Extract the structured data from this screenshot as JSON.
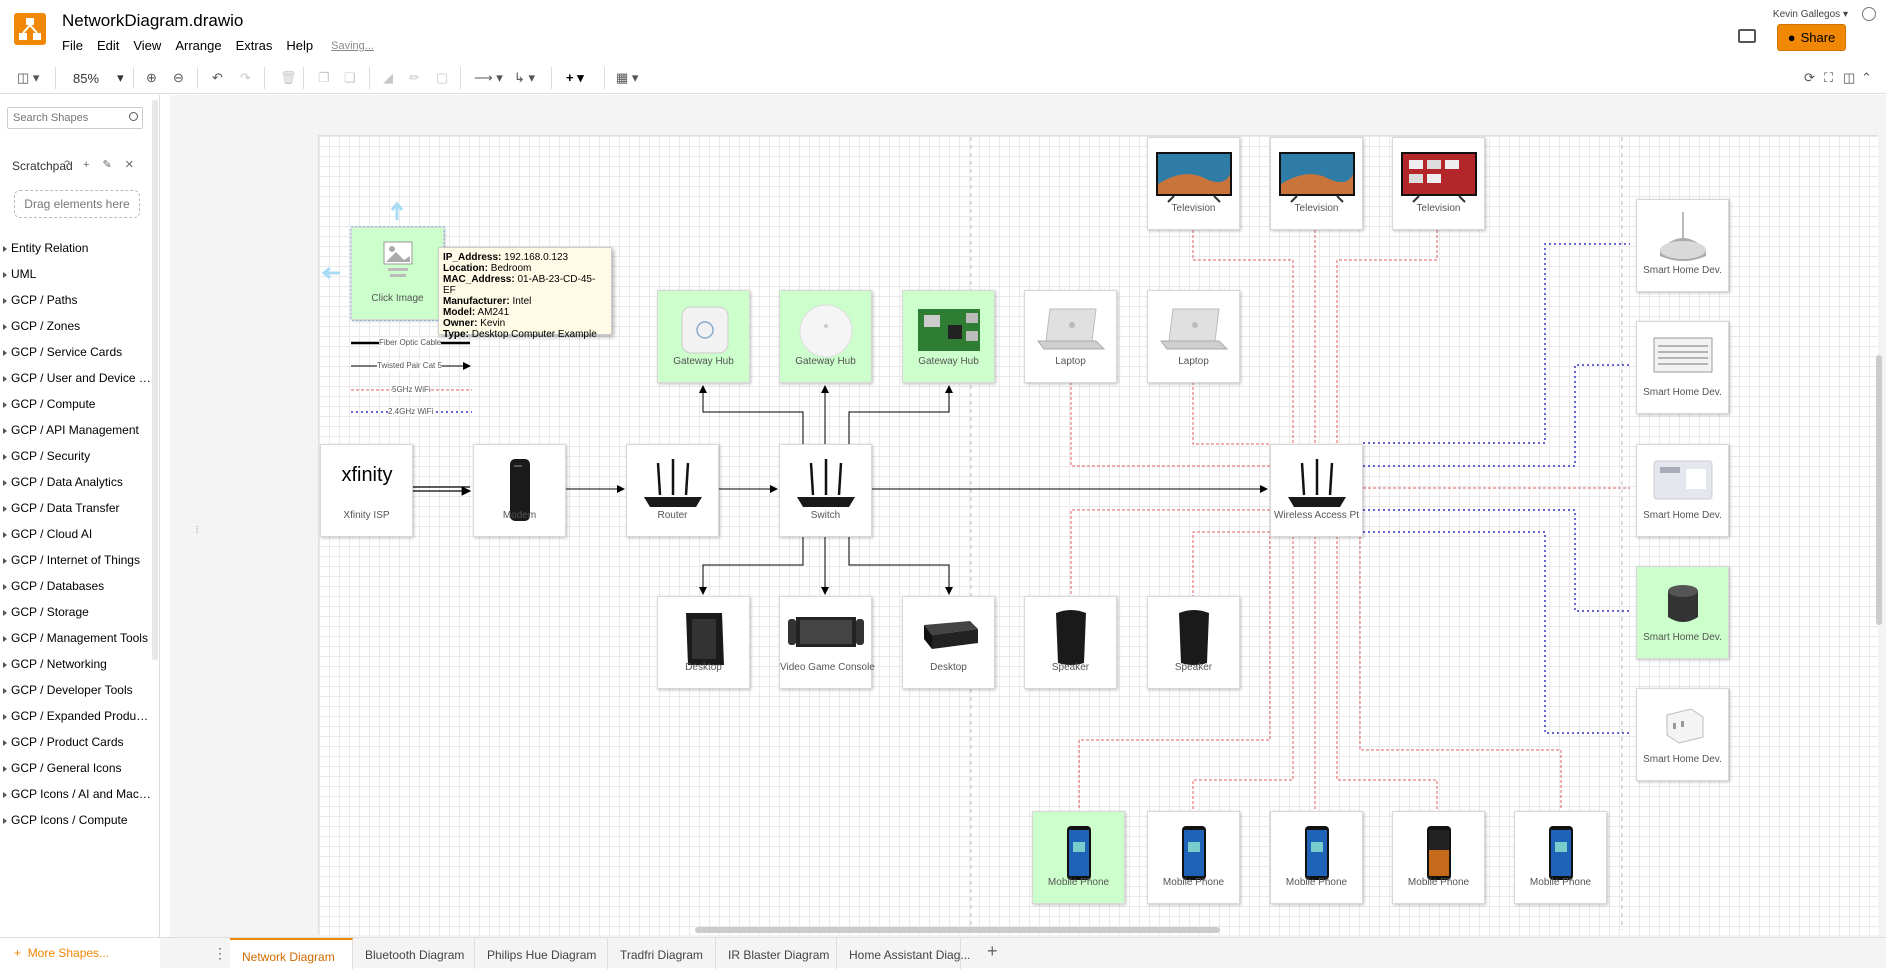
{
  "app": {
    "title": "NetworkDiagram.drawio",
    "menus": [
      "File",
      "Edit",
      "View",
      "Arrange",
      "Extras",
      "Help"
    ],
    "saving": "Saving...",
    "user": "Kevin Gallegos",
    "share_label": "Share"
  },
  "toolbar": {
    "zoom": "85%"
  },
  "sidebar": {
    "search_placeholder": "Search Shapes",
    "scratchpad_label": "Scratchpad",
    "scratchpad_tools": "? + ✎ ✕",
    "drag_here": "Drag elements here",
    "palettes": [
      "Entity Relation",
      "UML",
      "GCP / Paths",
      "GCP / Zones",
      "GCP / Service Cards",
      "GCP / User and Device Cards",
      "GCP / Compute",
      "GCP / API Management",
      "GCP / Security",
      "GCP / Data Analytics",
      "GCP / Data Transfer",
      "GCP / Cloud AI",
      "GCP / Internet of Things",
      "GCP / Databases",
      "GCP / Storage",
      "GCP / Management Tools",
      "GCP / Networking",
      "GCP / Developer Tools",
      "GCP / Expanded Product Cards",
      "GCP / Product Cards",
      "GCP / General Icons",
      "GCP Icons / AI and Machine L...",
      "GCP Icons / Compute"
    ],
    "more_shapes": "More Shapes..."
  },
  "diagram": {
    "nodes": [
      {
        "id": "click-image",
        "label": "Click Image",
        "green": true,
        "img": "placeholder"
      },
      {
        "id": "xfinity-isp",
        "label": "Xfinity ISP",
        "green": false,
        "img": "xfinity",
        "logo": "xfinity"
      },
      {
        "id": "modem",
        "label": "Modem",
        "green": false,
        "img": "modem"
      },
      {
        "id": "router",
        "label": "Router",
        "green": false,
        "img": "router"
      },
      {
        "id": "switch",
        "label": "Switch",
        "green": false,
        "img": "router"
      },
      {
        "id": "wap",
        "label": "Wireless Access Pt",
        "green": false,
        "img": "router"
      },
      {
        "id": "gateway-hub-1",
        "label": "Gateway Hub",
        "green": true,
        "img": "hub-square"
      },
      {
        "id": "gateway-hub-2",
        "label": "Gateway Hub",
        "green": true,
        "img": "hub-round"
      },
      {
        "id": "gateway-hub-3",
        "label": "Gateway Hub",
        "green": true,
        "img": "board"
      },
      {
        "id": "laptop-1",
        "label": "Laptop",
        "green": false,
        "img": "laptop"
      },
      {
        "id": "laptop-2",
        "label": "Laptop",
        "green": false,
        "img": "laptop"
      },
      {
        "id": "tv-1",
        "label": "Television",
        "green": false,
        "img": "tv"
      },
      {
        "id": "tv-2",
        "label": "Television",
        "green": false,
        "img": "tv"
      },
      {
        "id": "tv-3",
        "label": "Television",
        "green": false,
        "img": "tv-red"
      },
      {
        "id": "desktop-1",
        "label": "Desktop",
        "green": false,
        "img": "tower"
      },
      {
        "id": "game-console",
        "label": "Video Game Console",
        "green": false,
        "img": "console"
      },
      {
        "id": "desktop-2",
        "label": "Desktop",
        "green": false,
        "img": "minipc"
      },
      {
        "id": "speaker-1",
        "label": "Speaker",
        "green": false,
        "img": "speaker"
      },
      {
        "id": "speaker-2",
        "label": "Speaker",
        "green": false,
        "img": "speaker"
      },
      {
        "id": "smart-home-1",
        "label": "Smart Home Dev.",
        "green": false,
        "img": "mini-speaker"
      },
      {
        "id": "smart-home-2",
        "label": "Smart Home Dev.",
        "green": false,
        "img": "ac"
      },
      {
        "id": "smart-home-3",
        "label": "Smart Home Dev.",
        "green": false,
        "img": "display"
      },
      {
        "id": "smart-home-4",
        "label": "Smart Home Dev.",
        "green": true,
        "img": "speaker-small"
      },
      {
        "id": "smart-home-5",
        "label": "Smart Home Dev.",
        "green": false,
        "img": "plug"
      },
      {
        "id": "phone-1",
        "label": "Mobile Phone",
        "green": true,
        "img": "phone"
      },
      {
        "id": "phone-2",
        "label": "Mobile Phone",
        "green": false,
        "img": "phone"
      },
      {
        "id": "phone-3",
        "label": "Mobile Phone",
        "green": false,
        "img": "phone"
      },
      {
        "id": "phone-4",
        "label": "Mobile Phone",
        "green": false,
        "img": "phone-dark"
      },
      {
        "id": "phone-5",
        "label": "Mobile Phone",
        "green": false,
        "img": "phone"
      }
    ],
    "tooltip": [
      {
        "key": "IP_Address:",
        "value": " 192.168.0.123"
      },
      {
        "key": "Location:",
        "value": " Bedroom"
      },
      {
        "key": "MAC_Address:",
        "value": " 01-AB-23-CD-45-EF"
      },
      {
        "key": "Manufacturer:",
        "value": " Intel"
      },
      {
        "key": "Model:",
        "value": " AM241"
      },
      {
        "key": "Owner:",
        "value": " Kevin"
      },
      {
        "key": "Type:",
        "value": " Desktop Computer Example"
      }
    ],
    "legend": [
      "Fiber Optic Cable",
      "Twisted Pair Cat 5",
      "5GHz WiFi",
      "2.4GHz WiFi"
    ],
    "colors": {
      "wifi5": "#e06060",
      "wifi24": "#3333cc",
      "green_fill": "#ccffcc",
      "accent": "#f08705"
    }
  },
  "tabs": [
    "Network Diagram",
    "Bluetooth Diagram",
    "Philips Hue Diagram",
    "Tradfri Diagram",
    "IR Blaster Diagram",
    "Home Assistant Diag..."
  ]
}
